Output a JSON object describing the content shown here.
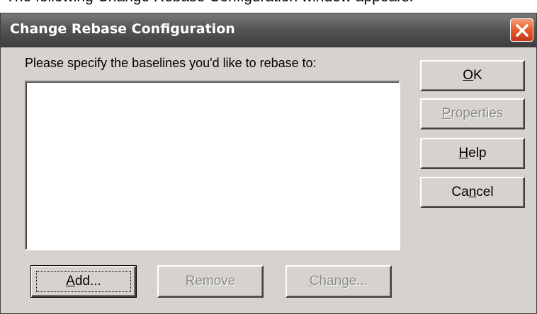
{
  "page": {
    "caption": "The following Change Rebase Configuration window appears:"
  },
  "dialog": {
    "title": "Change Rebase Configuration",
    "prompt": "Please specify the baselines you'd like to rebase to:",
    "baselines": []
  },
  "buttons": {
    "ok": {
      "mnemonic": "O",
      "rest": "K"
    },
    "properties": {
      "mnemonic": "P",
      "rest": "roperties"
    },
    "help": {
      "mnemonic": "H",
      "rest": "elp"
    },
    "cancel": {
      "pre": "Ca",
      "mnemonic": "n",
      "rest": "cel"
    },
    "add": {
      "mnemonic": "A",
      "rest": "dd..."
    },
    "remove": {
      "mnemonic": "R",
      "rest": "emove"
    },
    "change": {
      "mnemonic": "C",
      "rest": "hange..."
    }
  },
  "colors": {
    "dialog_face": "#d6d3ce",
    "close_button": "#e65a2a",
    "disabled_text": "#8a8a8a"
  }
}
